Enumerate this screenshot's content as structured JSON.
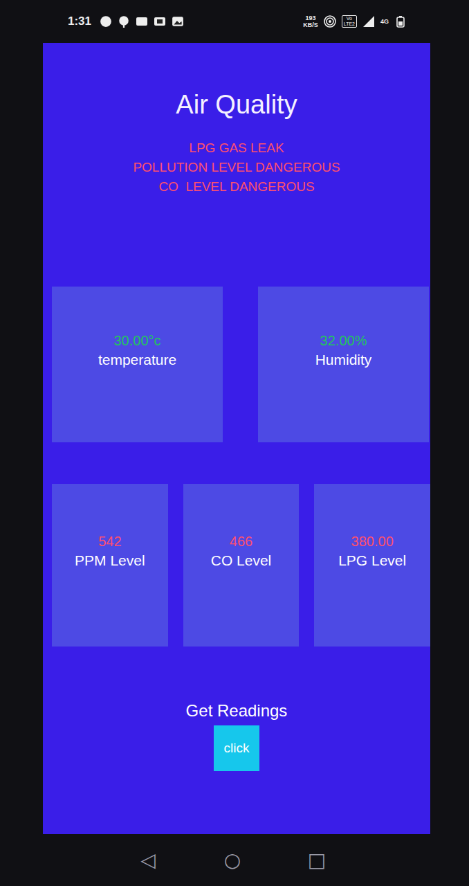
{
  "status_bar": {
    "time": "1:31",
    "speed_value": "193",
    "speed_unit": "KB/S",
    "volte_top": "Vo",
    "volte_bottom": "LTE2",
    "network": "4G"
  },
  "title": "Air Quality",
  "alerts": [
    "LPG GAS LEAK",
    "POLLUTION LEVEL DANGEROUS",
    "CO  LEVEL DANGEROUS"
  ],
  "top_cards": [
    {
      "value": "30.00°c",
      "label": "temperature",
      "color": "#22c55e"
    },
    {
      "value": "32.00%",
      "label": "Humidity",
      "color": "#22c55e"
    }
  ],
  "bottom_cards": [
    {
      "value": "542",
      "label": "PPM Level",
      "color": "#ff4f6e"
    },
    {
      "value": "466",
      "label": "CO Level",
      "color": "#ff4f6e"
    },
    {
      "value": "380.00",
      "label": "LPG Level",
      "color": "#ff4f6e"
    }
  ],
  "readings": {
    "heading": "Get Readings",
    "button": "click"
  },
  "nav_bar": [
    "◁",
    "○",
    "□"
  ]
}
